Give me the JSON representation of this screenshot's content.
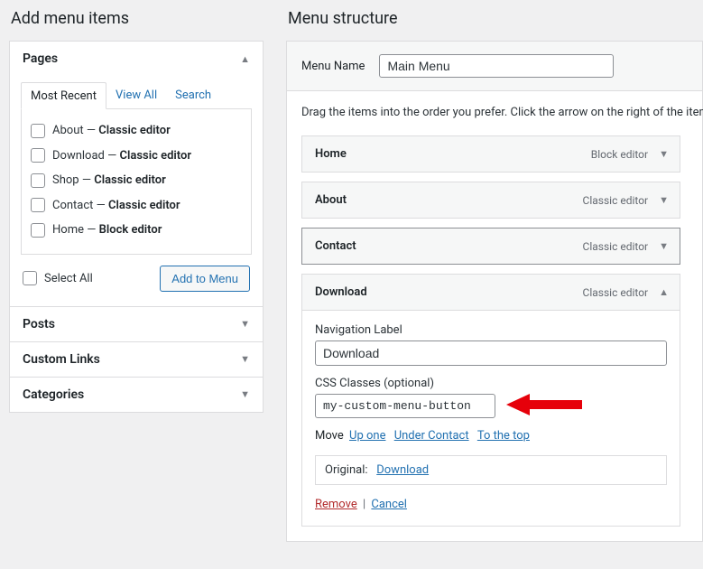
{
  "left": {
    "heading": "Add menu items",
    "sections": [
      {
        "title": "Pages",
        "expanded": true
      },
      {
        "title": "Posts",
        "expanded": false
      },
      {
        "title": "Custom Links",
        "expanded": false
      },
      {
        "title": "Categories",
        "expanded": false
      }
    ],
    "tabs": [
      {
        "label": "Most Recent",
        "active": true
      },
      {
        "label": "View All",
        "active": false
      },
      {
        "label": "Search",
        "active": false
      }
    ],
    "pages": [
      {
        "title": "About",
        "suffix": "Classic editor"
      },
      {
        "title": "Download",
        "suffix": "Classic editor"
      },
      {
        "title": "Shop",
        "suffix": "Classic editor"
      },
      {
        "title": "Contact",
        "suffix": "Classic editor"
      },
      {
        "title": "Home",
        "suffix": "Block editor"
      }
    ],
    "select_all_label": "Select All",
    "add_button": "Add to Menu"
  },
  "right": {
    "heading": "Menu structure",
    "menu_name_label": "Menu Name",
    "menu_name_value": "Main Menu",
    "hint": "Drag the items into the order you prefer. Click the arrow on the right of the item to reveal additional configuration options.",
    "items": [
      {
        "title": "Home",
        "type": "Block editor",
        "expanded": false
      },
      {
        "title": "About",
        "type": "Classic editor",
        "expanded": false
      },
      {
        "title": "Contact",
        "type": "Classic editor",
        "expanded": false
      },
      {
        "title": "Download",
        "type": "Classic editor",
        "expanded": true
      }
    ],
    "editor": {
      "nav_label_text": "Navigation Label",
      "nav_label_value": "Download",
      "css_label_text": "CSS Classes (optional)",
      "css_value": "my-custom-menu-button",
      "move_label": "Move",
      "move_up": "Up one",
      "move_under": "Under Contact",
      "move_top": "To the top",
      "original_label": "Original:",
      "original_link": "Download",
      "remove_label": "Remove",
      "cancel_label": "Cancel"
    }
  }
}
